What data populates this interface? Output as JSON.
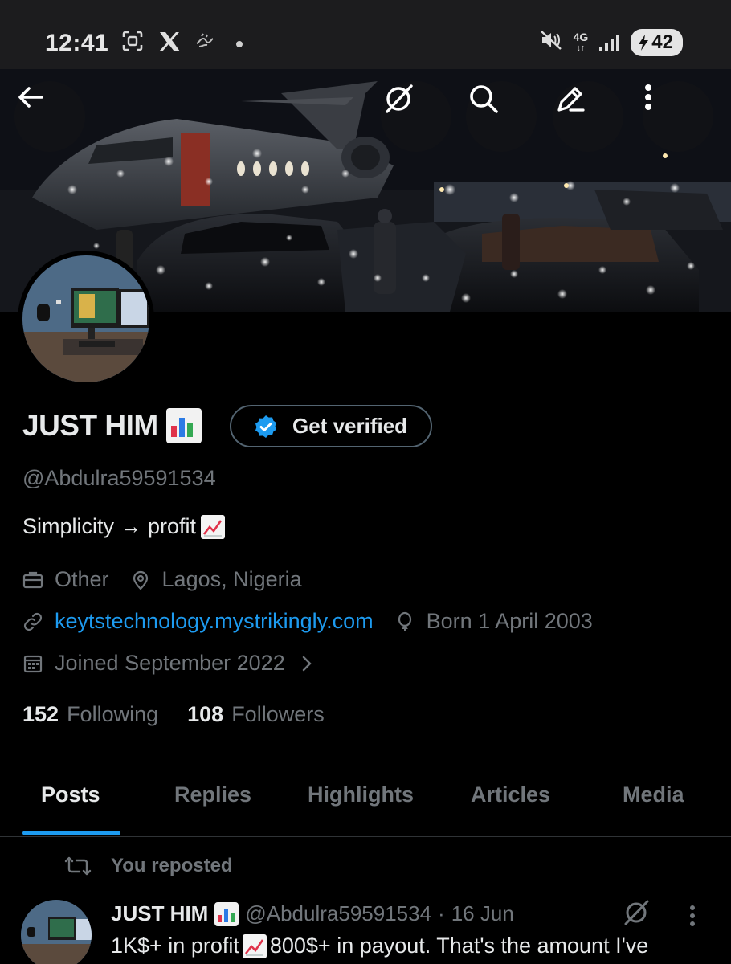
{
  "status_bar": {
    "time": "12:41",
    "network": "4G",
    "battery": "42"
  },
  "profile": {
    "display_name": "JUST HIM",
    "name_emoji": "bar-chart-emoji",
    "get_verified_label": "Get verified",
    "handle": "@Abdulra59591534",
    "bio": "Simplicity → profit",
    "bio_emoji": "chart-increasing-emoji",
    "category": "Other",
    "location": "Lagos, Nigeria",
    "website": "keytstechnology.mystrikingly.com",
    "birthday": "Born 1 April 2003",
    "joined": "Joined September 2022",
    "following_count": "152",
    "following_label": "Following",
    "followers_count": "108",
    "followers_label": "Followers"
  },
  "tabs": [
    {
      "label": "Posts",
      "active": true
    },
    {
      "label": "Replies",
      "active": false
    },
    {
      "label": "Highlights",
      "active": false
    },
    {
      "label": "Articles",
      "active": false
    },
    {
      "label": "Media",
      "active": false
    }
  ],
  "feed": {
    "repost_label": "You reposted",
    "post": {
      "name": "JUST HIM",
      "handle": "@Abdulra59591534",
      "separator": "·",
      "date": "16 Jun",
      "text_part1": "1K$+ in profit",
      "text_part2": "800$+ in payout. That's the amount I've"
    }
  },
  "colors": {
    "accent": "#1d9bf0",
    "background": "#000000",
    "muted_text": "#71767b",
    "primary_text": "#e7e9ea",
    "border": "#2f3336"
  }
}
